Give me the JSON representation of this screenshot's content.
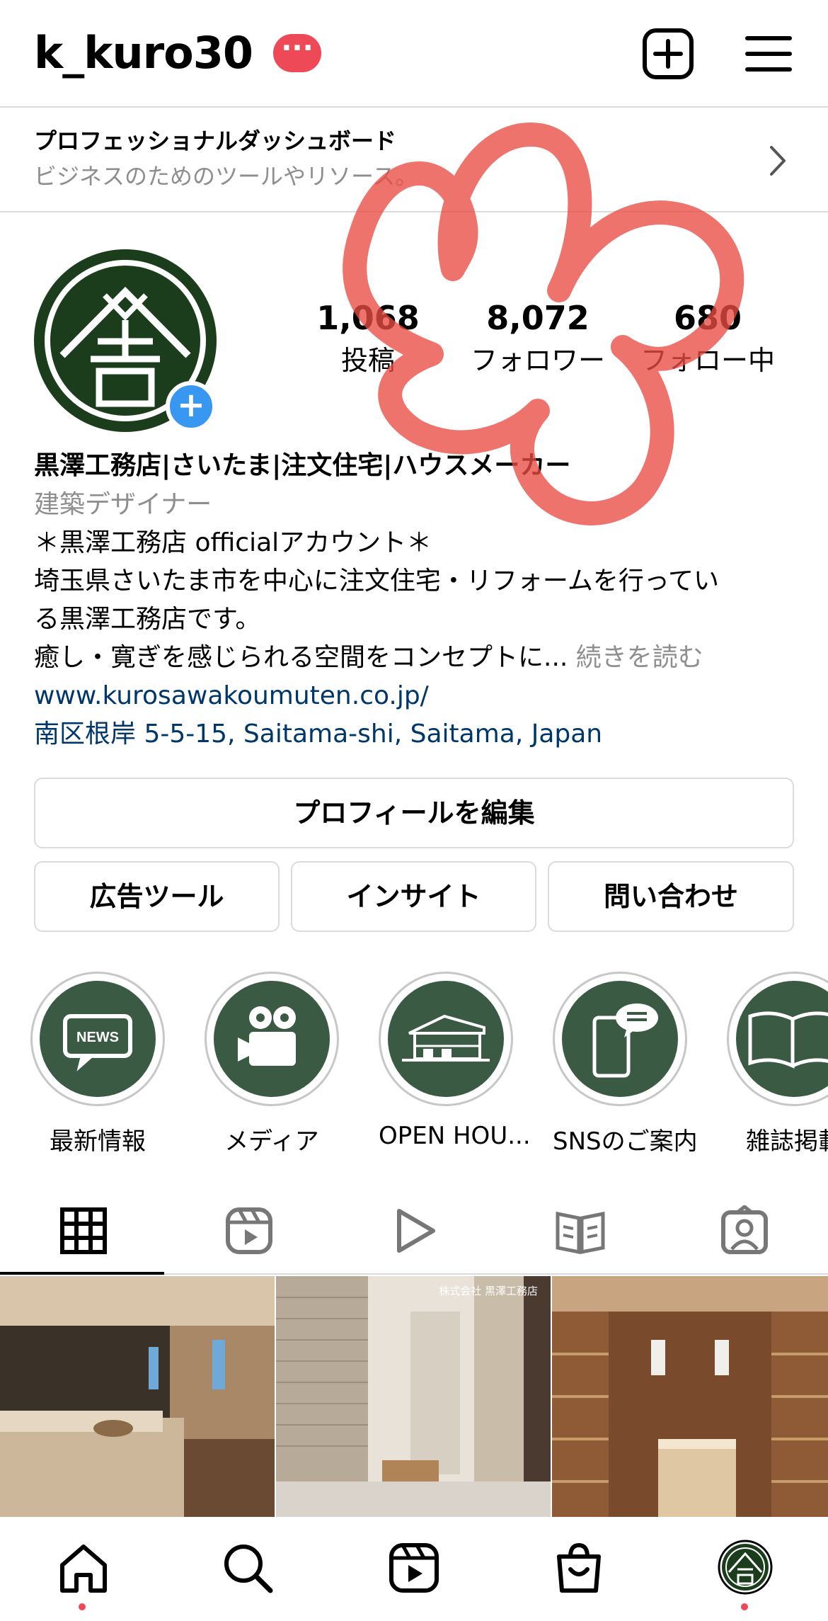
{
  "header": {
    "username": "k_kuro30",
    "badge": "···",
    "icons": [
      "new-post-icon",
      "menu-icon"
    ]
  },
  "dashboard": {
    "title": "プロフェッショナルダッシュボード",
    "subtitle": "ビジネスのためのツールやリソース。"
  },
  "profile": {
    "avatar_plus": "+",
    "stats": [
      {
        "value": "1,068",
        "label": "投稿"
      },
      {
        "value": "8,072",
        "label": "フォロワー"
      },
      {
        "value": "680",
        "label": "フォロー中"
      }
    ],
    "name": "黒澤工務店|さいたま|注文住宅|ハウスメーカー",
    "category": "建築デザイナー",
    "bio_lines": [
      "＊黒澤工務店 officialアカウント＊",
      "埼玉県さいたま市を中心に注文住宅・リフォームを行ってい",
      "る黒澤工務店です。",
      "癒し・寛ぎを感じられる空間をコンセプトに..."
    ],
    "more": "続きを読む",
    "website": "www.kurosawakoumuten.co.jp/",
    "address": "南区根岸 5-5-15, Saitama-shi, Saitama, Japan"
  },
  "buttons": {
    "edit_profile": "プロフィールを編集",
    "ad_tools": "広告ツール",
    "insights": "インサイト",
    "contact": "問い合わせ"
  },
  "highlights": [
    {
      "label": "最新情報",
      "icon": "news-icon",
      "icon_text": "NEWS"
    },
    {
      "label": "メディア",
      "icon": "video-camera-icon"
    },
    {
      "label": "OPEN HOU...",
      "icon": "house-icon"
    },
    {
      "label": "SNSのご案内",
      "icon": "smartphone-chat-icon"
    },
    {
      "label": "雑誌掲載",
      "icon": "book-icon"
    }
  ],
  "tabs": [
    "grid-icon",
    "reels-icon",
    "video-icon",
    "guide-icon",
    "tagged-icon"
  ],
  "posts": [
    {
      "name": "bedroom-photo"
    },
    {
      "name": "stone-wall-hallway-photo",
      "overlay": "株式会社 黒澤工務店"
    },
    {
      "name": "walk-in-closet-photo"
    }
  ],
  "nav": [
    "home-icon",
    "search-icon",
    "reels-icon",
    "shop-icon",
    "profile-avatar"
  ],
  "colors": {
    "accent_red": "#ed4956",
    "link_blue": "#00376b",
    "avatar_green": "#1c3d1c",
    "highlight_green": "#3b5a44",
    "plus_blue": "#3897f0",
    "doodle_red": "#e84b42"
  }
}
